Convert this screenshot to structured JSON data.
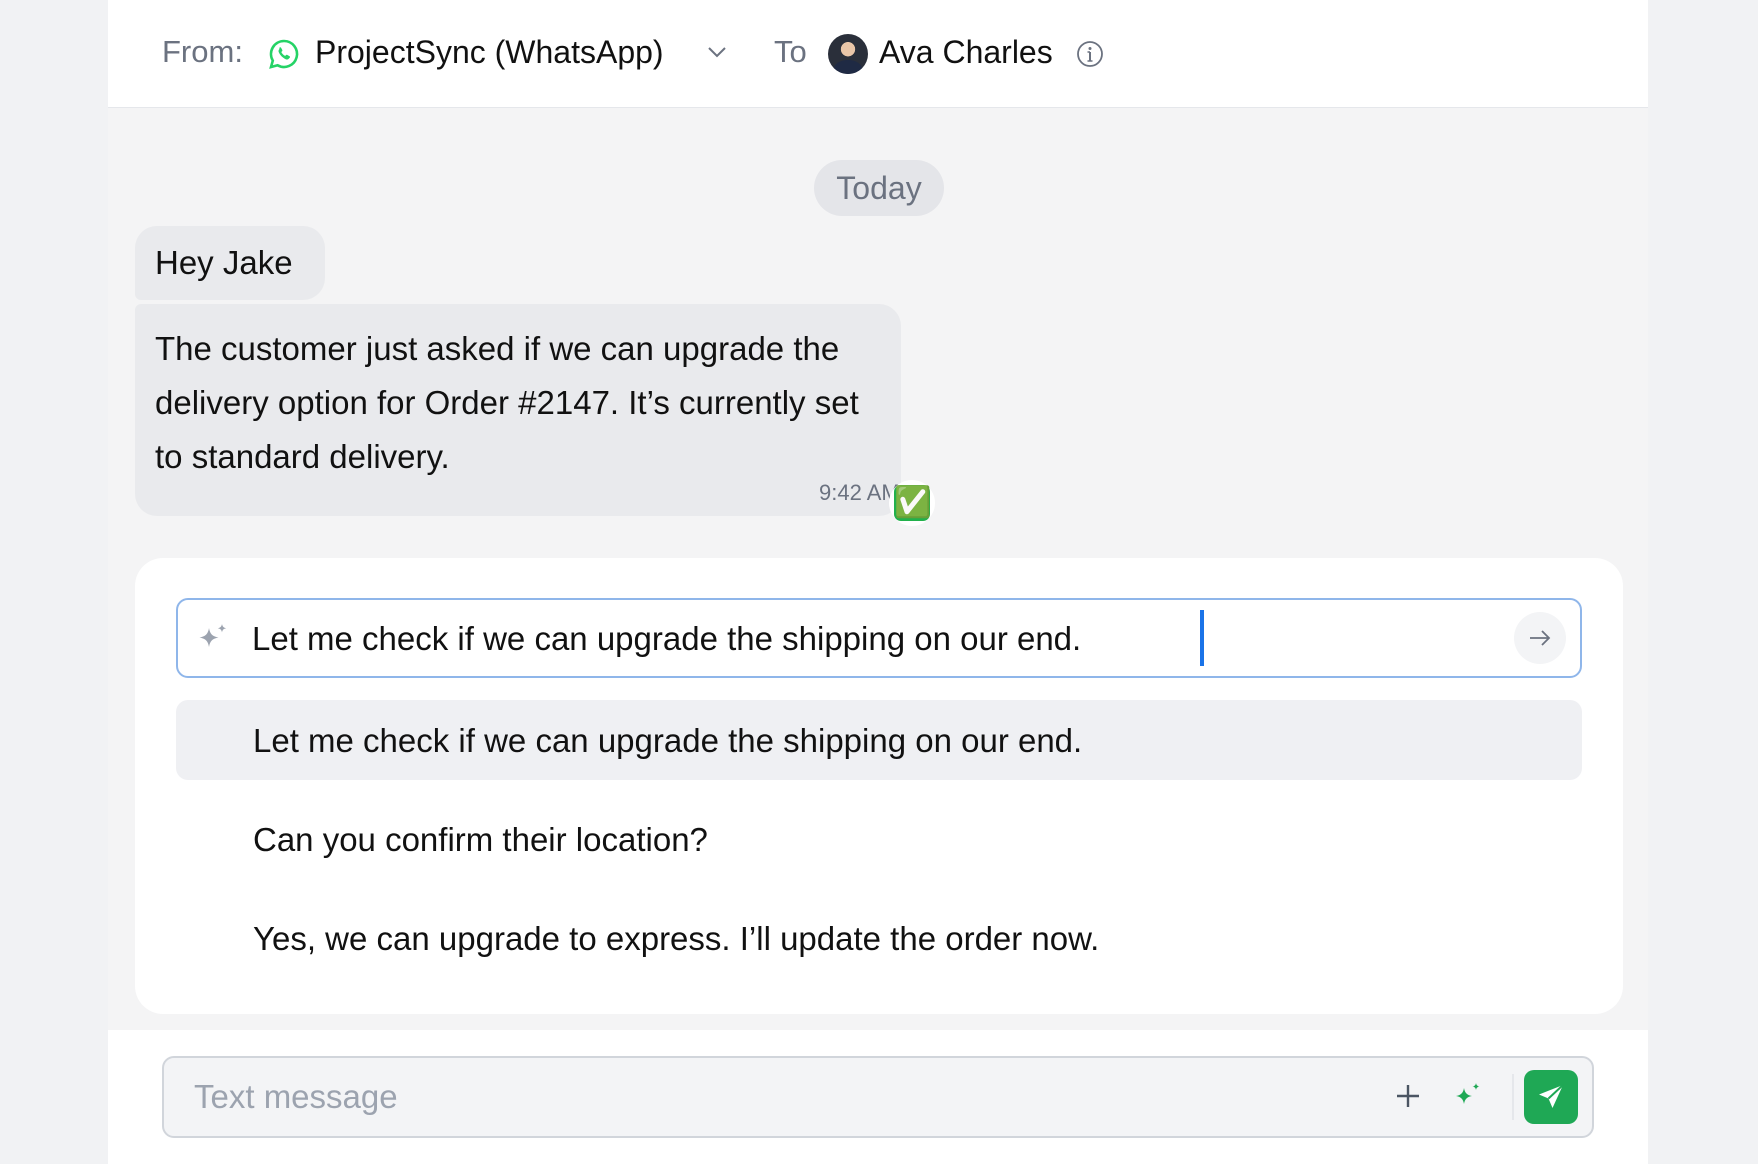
{
  "header": {
    "from_label": "From:",
    "channel_name": "ProjectSync (WhatsApp)",
    "to_label": "To",
    "contact_name": "Ava Charles"
  },
  "conversation": {
    "date_separator": "Today",
    "messages": [
      {
        "text": "Hey Jake"
      },
      {
        "text": "The customer just asked if we can upgrade the delivery option for Order #2147. It’s currently set to standard delivery.",
        "time": "9:42 AM",
        "reaction": "✅"
      }
    ]
  },
  "ai_compose": {
    "input_value": "Let me check if we can upgrade the shipping on our end.",
    "suggestions": [
      "Let me check if we can upgrade the shipping on our end.",
      "Can you confirm their location?",
      "Yes, we can upgrade to express. I’ll update the order now."
    ]
  },
  "composer": {
    "placeholder": "Text message"
  },
  "colors": {
    "accent_green": "#1fa855",
    "whatsapp_green": "#25d366",
    "focus_blue": "#8fb6ea"
  },
  "icons": [
    "whatsapp-icon",
    "chevron-down-icon",
    "info-icon",
    "sparkle-icon",
    "arrow-right-icon",
    "plus-icon",
    "send-icon",
    "check-icon"
  ]
}
